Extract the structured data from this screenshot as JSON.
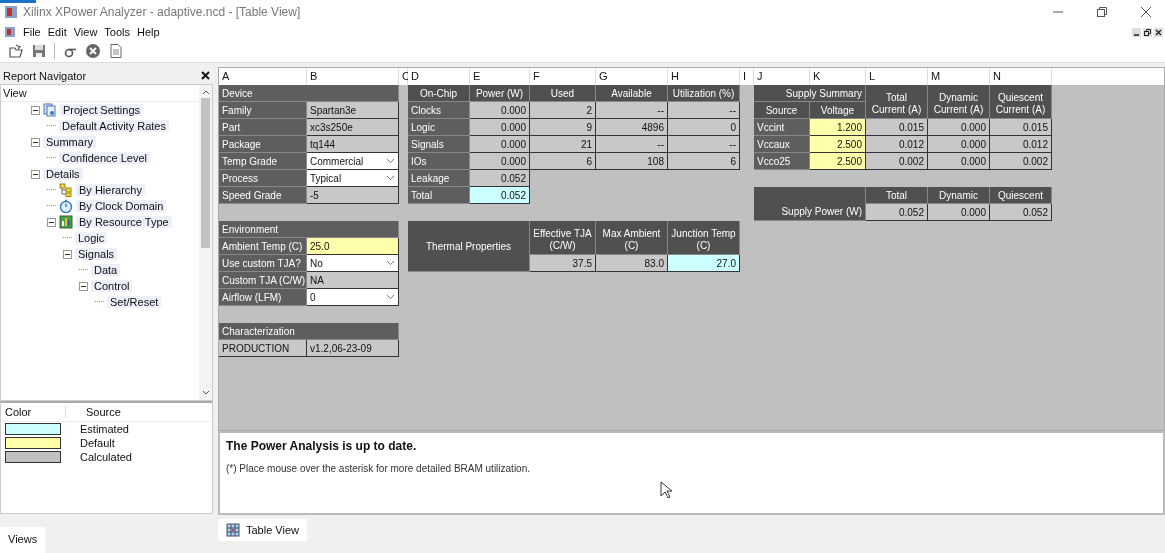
{
  "window": {
    "title": "Xilinx XPower Analyzer - adaptive.ncd - [Table View]"
  },
  "menu": [
    "File",
    "Edit",
    "View",
    "Tools",
    "Help"
  ],
  "navigator": {
    "title": "Report Navigator",
    "header": "View",
    "tree": [
      {
        "label": "Project Settings",
        "kind": "settings",
        "expanded": true,
        "children": [
          {
            "label": "Default Activity Rates"
          }
        ]
      },
      {
        "label": "Summary",
        "expanded": true,
        "children": [
          {
            "label": "Confidence Level"
          }
        ]
      },
      {
        "label": "Details",
        "expanded": true,
        "children": [
          {
            "label": "By Hierarchy",
            "kind": "hierarchy"
          },
          {
            "label": "By Clock Domain",
            "kind": "clock"
          },
          {
            "label": "By Resource Type",
            "kind": "chart",
            "expanded": true,
            "children": [
              {
                "label": "Logic"
              },
              {
                "label": "Signals",
                "expanded": true,
                "children": [
                  {
                    "label": "Data"
                  },
                  {
                    "label": "Control",
                    "expanded": true,
                    "children": [
                      {
                        "label": "Set/Reset"
                      }
                    ]
                  }
                ]
              }
            ]
          }
        ]
      }
    ]
  },
  "legend": {
    "columns": [
      "Color",
      "Source"
    ],
    "items": [
      {
        "label": "Estimated",
        "color": "#ccffff"
      },
      {
        "label": "Default",
        "color": "#ffffaa"
      },
      {
        "label": "Calculated",
        "color": "#c0c0c0"
      }
    ]
  },
  "sheet": {
    "columns": [
      "A",
      "B",
      "C",
      "D",
      "E",
      "F",
      "G",
      "H",
      "I",
      "J",
      "K",
      "L",
      "M",
      "N"
    ],
    "device": {
      "title": "Device",
      "rows": [
        {
          "label": "Family",
          "value": "Spartan3e",
          "kind": "text",
          "color": "#c8c8c8"
        },
        {
          "label": "Part",
          "value": "xc3s250e",
          "kind": "text",
          "color": "#c8c8c8"
        },
        {
          "label": "Package",
          "value": "tq144",
          "kind": "text",
          "color": "#c8c8c8"
        },
        {
          "label": "Temp Grade",
          "value": "Commercial",
          "kind": "dropdown",
          "color": "#ffffff"
        },
        {
          "label": "Process",
          "value": "Typical",
          "kind": "dropdown",
          "color": "#ffffff"
        },
        {
          "label": "Speed Grade",
          "value": "-5",
          "kind": "text",
          "color": "#c8c8c8"
        }
      ]
    },
    "environment": {
      "title": "Environment",
      "rows": [
        {
          "label": "Ambient Temp (C)",
          "value": "25.0",
          "kind": "text",
          "color": "#ffffaa"
        },
        {
          "label": "Use custom TJA?",
          "value": "No",
          "kind": "dropdown",
          "color": "#ffffff"
        },
        {
          "label": "Custom TJA (C/W)",
          "value": "NA",
          "kind": "text",
          "color": "#c8c8c8"
        },
        {
          "label": "Airflow (LFM)",
          "value": "0",
          "kind": "dropdown",
          "color": "#ffffff"
        }
      ]
    },
    "characterization": {
      "title": "Characterization",
      "name": "PRODUCTION",
      "version": "v1.2,06-23-09"
    },
    "on_chip": {
      "columns": [
        "On-Chip",
        "Power (W)",
        "Used",
        "Available",
        "Utilization (%)"
      ],
      "rows": [
        {
          "name": "Clocks",
          "power": "0.000",
          "used": "2",
          "available": "--",
          "utilization": "--"
        },
        {
          "name": "Logic",
          "power": "0.000",
          "used": "9",
          "available": "4896",
          "utilization": "0"
        },
        {
          "name": "Signals",
          "power": "0.000",
          "used": "21",
          "available": "--",
          "utilization": "--"
        },
        {
          "name": "IOs",
          "power": "0.000",
          "used": "6",
          "available": "108",
          "utilization": "6"
        }
      ],
      "totals": [
        {
          "label": "Leakage",
          "value": "0.052",
          "color": "#c8c8c8"
        },
        {
          "label": "Total",
          "value": "0.052",
          "color": "#ccffff"
        }
      ]
    },
    "thermal": {
      "title": "Thermal  Properties",
      "columns": [
        "Effective TJA\n(C/W)",
        "Max Ambient\n(C)",
        "Junction Temp\n(C)"
      ],
      "values": [
        {
          "text": "37.5",
          "color": "#c8c8c8"
        },
        {
          "text": "83.0",
          "color": "#c8c8c8"
        },
        {
          "text": "27.0",
          "color": "#ccffff"
        }
      ]
    },
    "supply": {
      "title": "Supply  Summary",
      "columns": [
        "Source",
        "Voltage",
        "Total\nCurrent (A)",
        "Dynamic\nCurrent (A)",
        "Quiescent\nCurrent (A)"
      ],
      "rows": [
        {
          "source": "Vccint",
          "voltage": {
            "text": "1.200",
            "color": "#ffffaa"
          },
          "total": "0.015",
          "dynamic": "0.000",
          "quiescent": "0.015"
        },
        {
          "source": "Vccaux",
          "voltage": {
            "text": "2.500",
            "color": "#ffffaa"
          },
          "total": "0.012",
          "dynamic": "0.000",
          "quiescent": "0.012"
        },
        {
          "source": "Vcco25",
          "voltage": {
            "text": "2.500",
            "color": "#ffffaa"
          },
          "total": "0.002",
          "dynamic": "0.000",
          "quiescent": "0.002"
        }
      ]
    },
    "supply_power": {
      "title": "Supply  Power (W)",
      "columns": [
        "Total",
        "Dynamic",
        "Quiescent"
      ],
      "values": [
        "0.052",
        "0.000",
        "0.052"
      ]
    }
  },
  "message": {
    "title": "The Power Analysis is up to date.",
    "note": "(*) Place mouse over the asterisk for more detailed BRAM utilization."
  },
  "left_tab": "Views",
  "doc_tabs": [
    {
      "label": "Table View",
      "selected": true
    }
  ]
}
